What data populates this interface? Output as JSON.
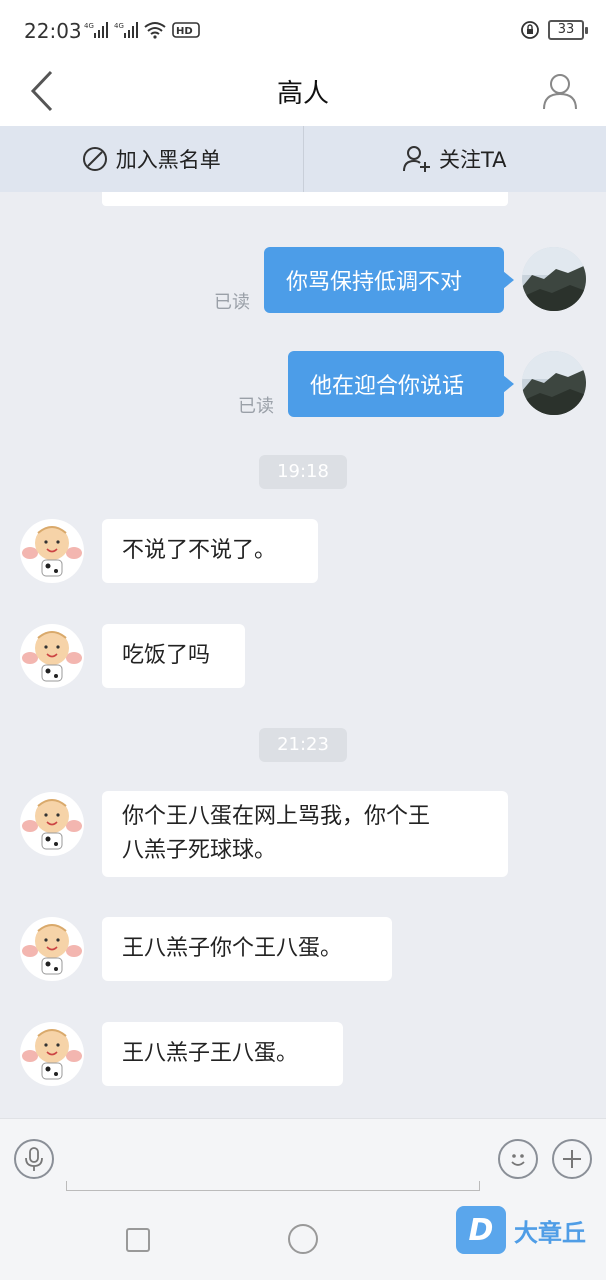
{
  "status": {
    "time": "22:03",
    "signal1": "4G",
    "signal2": "4G",
    "hd": "HD",
    "battery": "33"
  },
  "header": {
    "title": "高人"
  },
  "actions": {
    "blacklist": "加入黑名单",
    "follow": "关注TA"
  },
  "messages": {
    "out1": {
      "text": "你骂保持低调不对",
      "status": "已读"
    },
    "out2": {
      "text": "他在迎合你说话",
      "status": "已读"
    },
    "time1": "19:18",
    "in1": "不说了不说了。",
    "in2": "吃饭了吗",
    "time2": "21:23",
    "in3_line1": "你个王八蛋在网上骂我，你个王",
    "in3_line2": "八羔子死球球。",
    "in4": "王八羔子你个王八蛋。",
    "in5": "王八羔子王八蛋。"
  },
  "watermark": {
    "logo": "D",
    "text": "大章丘"
  },
  "icons": {
    "back": "chevron-left-icon",
    "profile": "person-icon",
    "blacklist": "block-icon",
    "follow": "add-person-icon",
    "voice": "microphone-icon",
    "emoji": "smiley-icon",
    "plus": "plus-icon"
  },
  "colors": {
    "outgoing_bubble": "#4c9de8",
    "background": "#ebedf2",
    "actionbar": "#dfe5ef"
  }
}
